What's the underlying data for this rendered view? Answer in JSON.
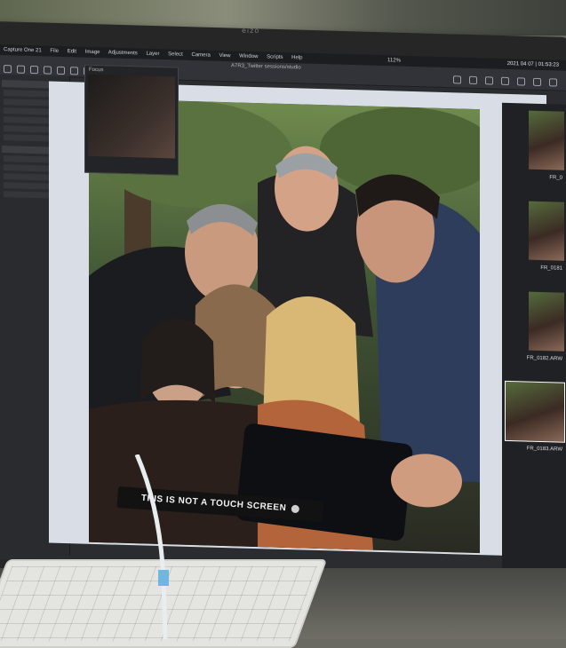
{
  "monitor": {
    "brand": "eizo"
  },
  "menubar": {
    "items": [
      "Capture One 21",
      "File",
      "Edit",
      "Image",
      "Adjustments",
      "Layer",
      "Select",
      "Camera",
      "View",
      "Window",
      "Scripts",
      "Help"
    ],
    "zoom": "112%",
    "datetime": "2021 04 07 | 01:53:23"
  },
  "toolbar": {
    "document_title": "A7R3_Twitter sessions/studio"
  },
  "focus_panel": {
    "title": "Focus"
  },
  "filmstrip": {
    "items": [
      "FR_0",
      "FR_0181",
      "FR_0182.ARW",
      "FR_0183.ARW"
    ]
  },
  "notice": {
    "text": "THIS IS NOT A TOUCH SCREEN"
  }
}
